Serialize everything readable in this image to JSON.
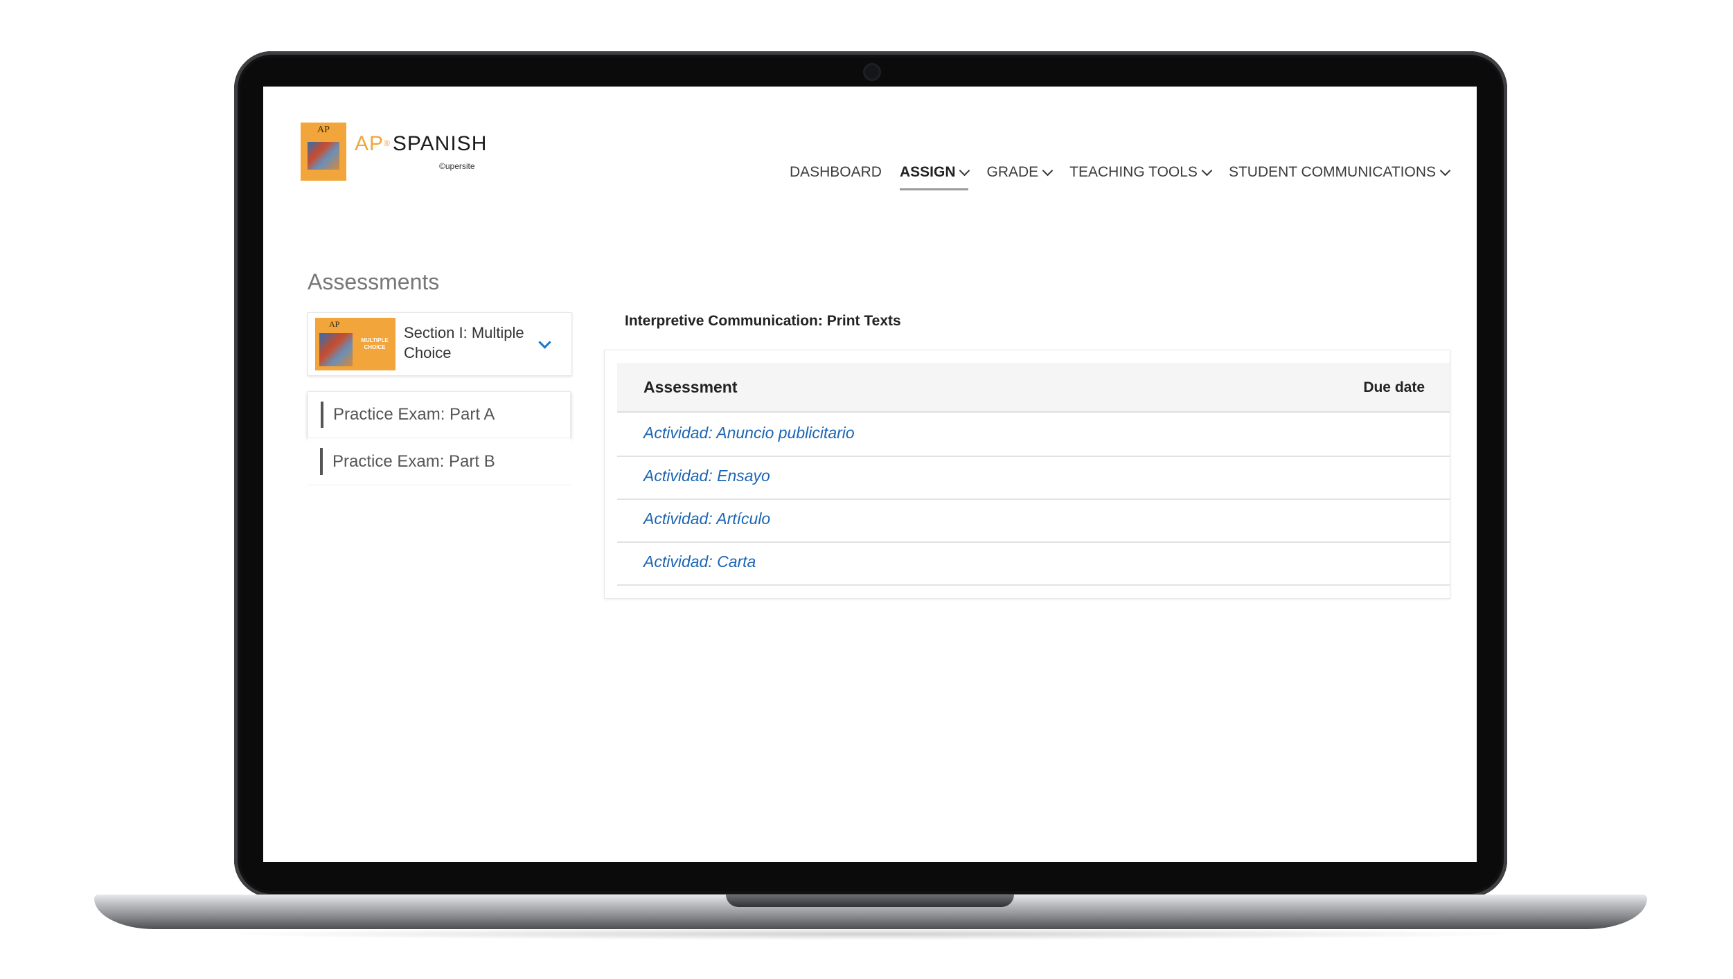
{
  "brand": {
    "ap": "AP",
    "registered": "®",
    "name": "SPANISH",
    "supersite": "©upersite",
    "book_title": "AP"
  },
  "nav": {
    "items": [
      {
        "label": "DASHBOARD",
        "dropdown": false,
        "active": false
      },
      {
        "label": "ASSIGN",
        "dropdown": true,
        "active": true
      },
      {
        "label": "GRADE",
        "dropdown": true,
        "active": false
      },
      {
        "label": "TEACHING TOOLS",
        "dropdown": true,
        "active": false
      },
      {
        "label": "STUDENT COMMUNICATIONS",
        "dropdown": true,
        "active": false
      }
    ]
  },
  "sidebar": {
    "title": "Assessments",
    "section": {
      "label": "Section I: Multiple Choice",
      "thumb_ap": "AP",
      "thumb_label": "MULTIPLE CHOICE"
    },
    "items": [
      {
        "label": "Practice Exam: Part A",
        "selected": true
      },
      {
        "label": "Practice Exam: Part B",
        "selected": false
      }
    ]
  },
  "main": {
    "heading": "Interpretive Communication: Print Texts",
    "table": {
      "col_assessment": "Assessment",
      "col_due": "Due date",
      "rows": [
        {
          "title": "Actividad: Anuncio publicitario",
          "due": ""
        },
        {
          "title": "Actividad: Ensayo",
          "due": ""
        },
        {
          "title": "Actividad: Artículo",
          "due": ""
        },
        {
          "title": "Actividad: Carta",
          "due": ""
        }
      ]
    }
  },
  "colors": {
    "brand_orange": "#f1a53a",
    "link_blue": "#1a64b4",
    "chevron_blue": "#1a77c9"
  }
}
